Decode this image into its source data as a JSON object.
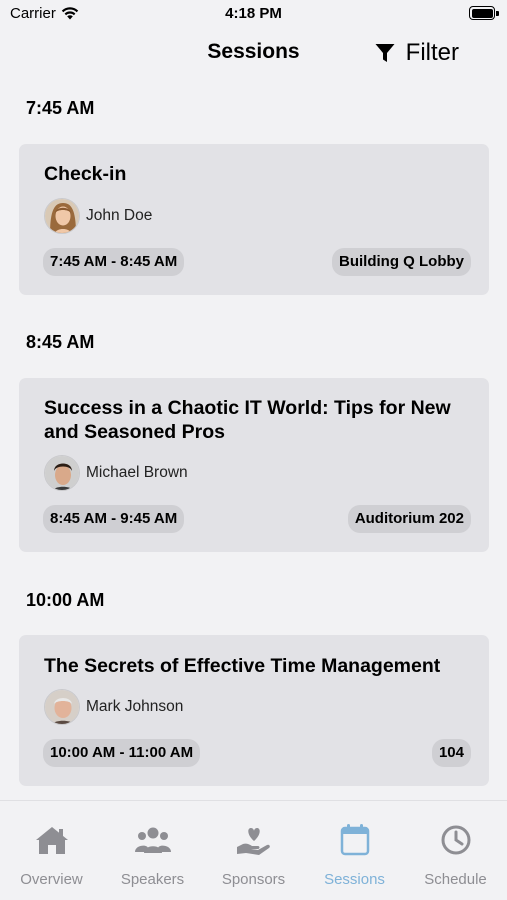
{
  "status_bar": {
    "carrier": "Carrier",
    "time": "4:18 PM"
  },
  "nav": {
    "title": "Sessions",
    "filter_label": "Filter"
  },
  "sessions": [
    {
      "time_header": "7:45 AM",
      "title": "Check-in",
      "speaker": "John Doe",
      "time_range": "7:45 AM  - 8:45 AM",
      "room": "Building Q Lobby"
    },
    {
      "time_header": "8:45 AM",
      "title": "Success in a Chaotic IT World: Tips for New and Seasoned Pros",
      "speaker": "Michael Brown",
      "time_range": "8:45 AM  - 9:45 AM",
      "room": "Auditorium 202"
    },
    {
      "time_header": "10:00 AM",
      "title": "The Secrets of Effective Time Management",
      "speaker": "Mark Johnson",
      "time_range": "10:00 AM  - 11:00 AM",
      "room": "104"
    }
  ],
  "tabs": [
    {
      "label": "Overview",
      "icon": "house-icon"
    },
    {
      "label": "Speakers",
      "icon": "people-group-icon"
    },
    {
      "label": "Sponsors",
      "icon": "hand-heart-icon"
    },
    {
      "label": "Sessions",
      "icon": "calendar-icon",
      "active": true
    },
    {
      "label": "Schedule",
      "icon": "clock-icon"
    }
  ],
  "colors": {
    "background": "#f2f2f4",
    "card": "#e2e2e6",
    "pill": "#cfcfd3",
    "tab_inactive": "#8e8e93",
    "tab_active": "#7fb2d8"
  }
}
